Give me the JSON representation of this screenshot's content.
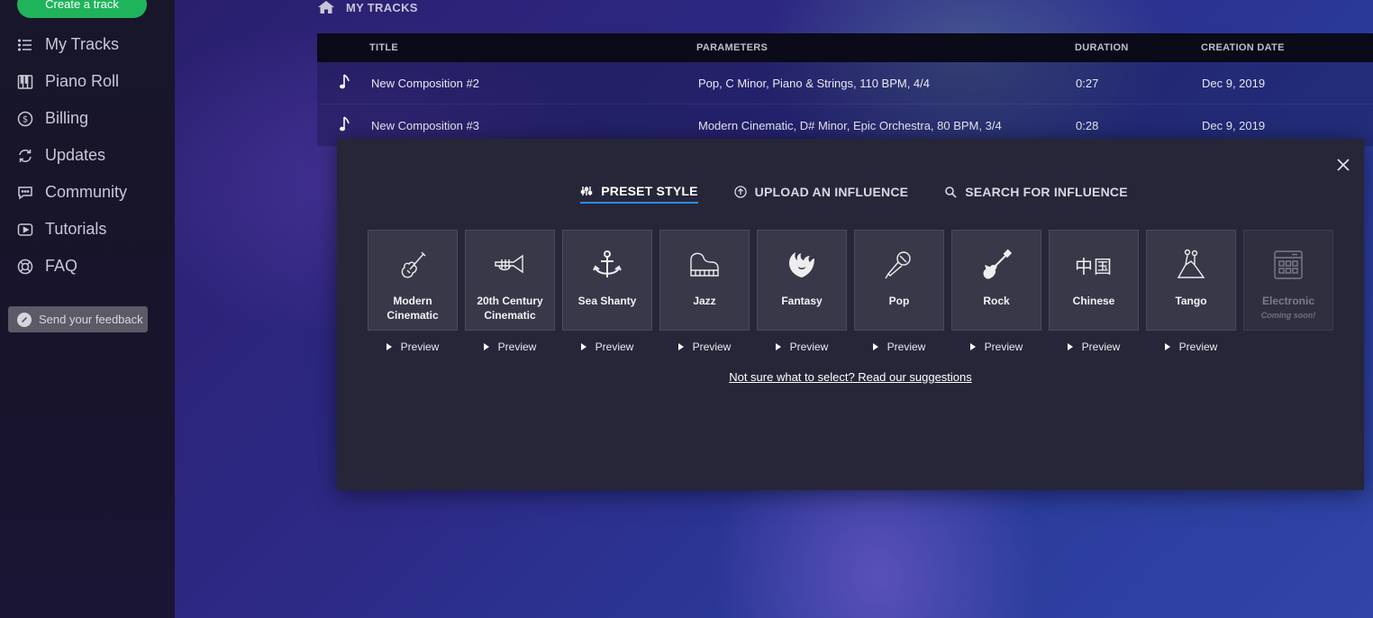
{
  "sidebar": {
    "create_label": "Create a track",
    "items": [
      {
        "label": "My Tracks",
        "icon": "list-icon"
      },
      {
        "label": "Piano Roll",
        "icon": "piano-icon"
      },
      {
        "label": "Billing",
        "icon": "dollar-icon"
      },
      {
        "label": "Updates",
        "icon": "refresh-icon"
      },
      {
        "label": "Community",
        "icon": "chat-icon"
      },
      {
        "label": "Tutorials",
        "icon": "play-icon"
      },
      {
        "label": "FAQ",
        "icon": "lifebuoy-icon"
      }
    ],
    "feedback_label": "Send your feedback"
  },
  "breadcrumb": {
    "label": "MY TRACKS"
  },
  "table": {
    "headers": {
      "title": "TITLE",
      "params": "PARAMETERS",
      "duration": "DURATION",
      "date": "CREATION DATE"
    },
    "rows": [
      {
        "title": "New Composition #2",
        "params": "Pop, C Minor, Piano & Strings, 110 BPM, 4/4",
        "duration": "0:27",
        "date": "Dec 9, 2019"
      },
      {
        "title": "New Composition #3",
        "params": "Modern Cinematic, D# Minor, Epic Orchestra, 80 BPM, 3/4",
        "duration": "0:28",
        "date": "Dec 9, 2019"
      }
    ]
  },
  "modal": {
    "tabs": [
      {
        "label": "PRESET STYLE",
        "active": true
      },
      {
        "label": "UPLOAD AN INFLUENCE",
        "active": false
      },
      {
        "label": "SEARCH FOR INFLUENCE",
        "active": false
      }
    ],
    "styles": [
      {
        "label": "Modern Cinematic",
        "icon": "violin-icon"
      },
      {
        "label": "20th Century Cinematic",
        "icon": "trumpet-icon"
      },
      {
        "label": "Sea Shanty",
        "icon": "anchor-icon"
      },
      {
        "label": "Jazz",
        "icon": "grand-piano-icon"
      },
      {
        "label": "Fantasy",
        "icon": "dragon-icon"
      },
      {
        "label": "Pop",
        "icon": "microphone-icon"
      },
      {
        "label": "Rock",
        "icon": "electric-guitar-icon"
      },
      {
        "label": "Chinese",
        "icon": "chinese-characters-icon"
      },
      {
        "label": "Tango",
        "icon": "dancers-icon"
      },
      {
        "label": "Electronic",
        "icon": "drum-pad-icon",
        "sub": "Coming soon!"
      }
    ],
    "preview_label": "Preview",
    "suggest_link": "Not sure what to select? Read our suggestions",
    "chinese_glyph": "中国"
  },
  "colors": {
    "accent": "#2f8cf2",
    "create_green": "#1fb45b"
  }
}
